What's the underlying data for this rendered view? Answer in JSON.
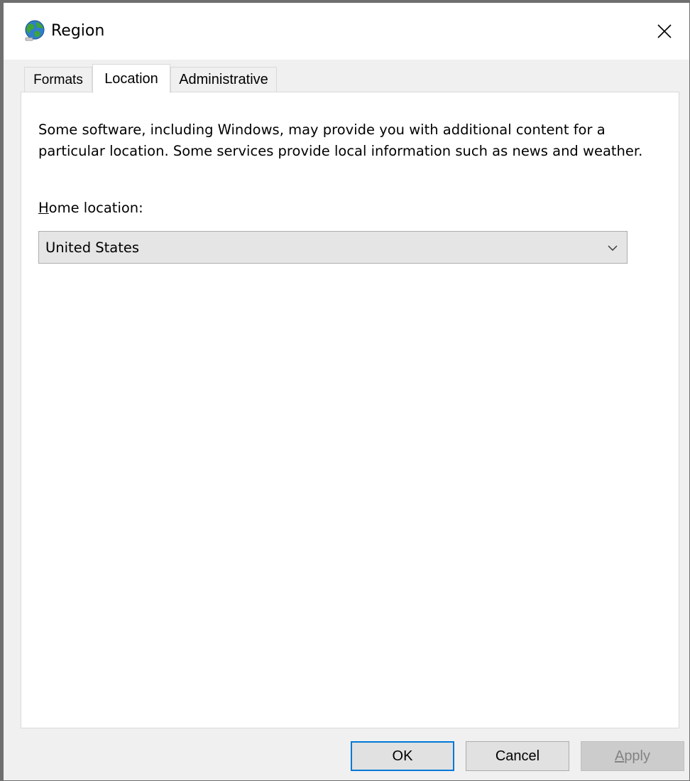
{
  "window": {
    "title": "Region",
    "icon": "region-globe-icon",
    "close_icon": "close-icon"
  },
  "tabs": [
    {
      "label": "Formats",
      "selected": false
    },
    {
      "label": "Location",
      "selected": true
    },
    {
      "label": "Administrative",
      "selected": false
    }
  ],
  "location_tab": {
    "description": "Some software, including Windows, may provide you with additional content for a particular location. Some services provide local information such as news and weather.",
    "home_location_label_accesskey": "H",
    "home_location_label_rest": "ome location:",
    "home_location_value": "United States"
  },
  "buttons": {
    "ok": "OK",
    "cancel": "Cancel",
    "apply_accesskey": "A",
    "apply_rest": "pply"
  },
  "colors": {
    "accent": "#0078d7",
    "window_bg": "#f0f0f0",
    "panel_bg": "#ffffff",
    "disabled_text": "#838383"
  }
}
